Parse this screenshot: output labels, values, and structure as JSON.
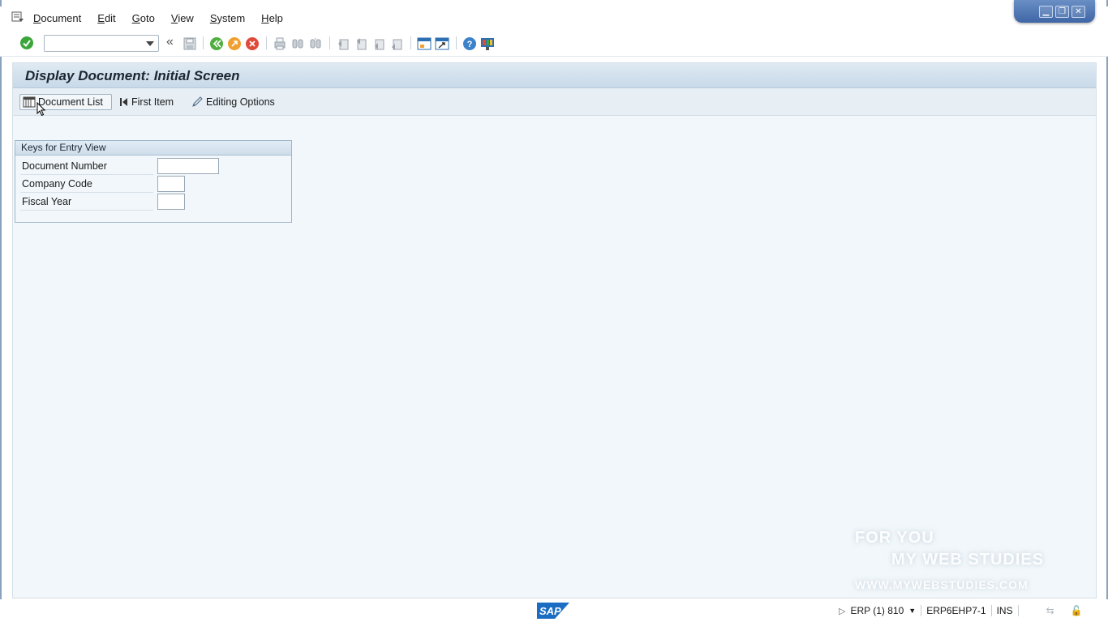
{
  "menu": {
    "items": [
      {
        "label": "Document",
        "accel": "D",
        "rest": "ocument"
      },
      {
        "label": "Edit",
        "accel": "E",
        "rest": "dit"
      },
      {
        "label": "Goto",
        "accel": "G",
        "rest": "oto"
      },
      {
        "label": "View",
        "accel": "V",
        "rest": "iew"
      },
      {
        "label": "System",
        "accel": "S",
        "rest": "ystem"
      },
      {
        "label": "Help",
        "accel": "H",
        "rest": "elp"
      }
    ]
  },
  "toolbar": {
    "command_field_value": "",
    "icons": [
      "enter-icon",
      "back-double-arrow-icon",
      "save-icon",
      "back-icon",
      "exit-icon",
      "cancel-icon",
      "print-icon",
      "find-icon",
      "find-next-icon",
      "first-page-icon",
      "previous-page-icon",
      "next-page-icon",
      "last-page-icon",
      "new-session-icon",
      "shortcut-icon",
      "help-icon",
      "customize-layout-icon"
    ]
  },
  "screen": {
    "title": "Display Document: Initial Screen",
    "buttons": {
      "document_list": "Document List",
      "first_item": "First Item",
      "editing_options": "Editing Options"
    }
  },
  "group": {
    "title": "Keys for Entry View",
    "fields": [
      {
        "label": "Document Number",
        "value": ""
      },
      {
        "label": "Company Code",
        "value": ""
      },
      {
        "label": "Fiscal Year",
        "value": ""
      }
    ]
  },
  "watermark": {
    "line1": "FOR YOU",
    "line2": "MY WEB STUDIES",
    "line3": "WWW.MYWEBSTUDIES.COM"
  },
  "status": {
    "logo": "SAP",
    "system": "ERP (1) 810",
    "server": "ERP6EHP7-1",
    "mode": "INS"
  },
  "colors": {
    "accent_green": "#3aa53a",
    "exit_orange": "#f0a030",
    "cancel_red": "#e04a3a",
    "sap_blue": "#1a6dc2",
    "content_bg": "#f1f7fa"
  }
}
